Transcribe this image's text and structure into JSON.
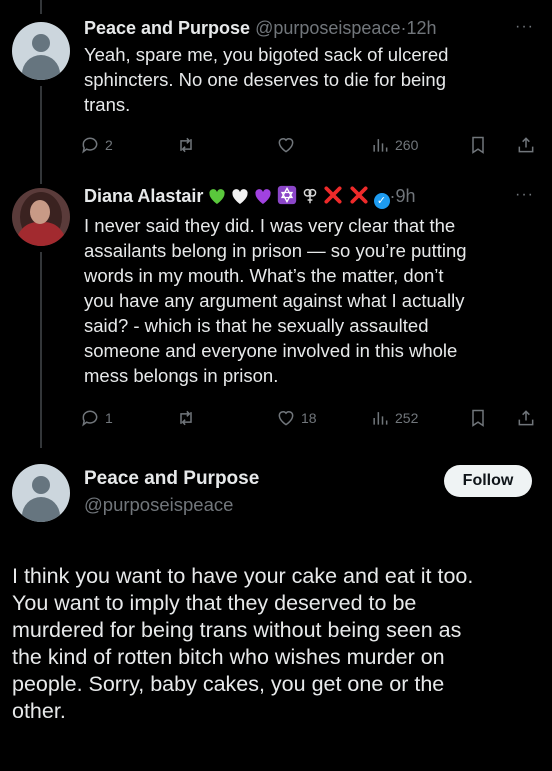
{
  "tweets": [
    {
      "name": "Peace and Purpose",
      "handle": "@purposeispeace",
      "separator": "·",
      "time": "12h",
      "text": "Yeah, spare me, you bigoted sack of ulcered\nsphincters. No one deserves to die for being\ntrans.",
      "replies": "2",
      "retweets": "",
      "likes": "",
      "views": "260"
    },
    {
      "name": "Diana Alastair",
      "name_emojis": [
        "green-heart",
        "white-heart",
        "purple-heart",
        "star-of-david",
        "gender-symbol",
        "red-x",
        "red-x"
      ],
      "separator": "·",
      "time": "9h",
      "text": "I never said they did. I was very clear that the\nassailants belong in prison — so you’re putting\nwords in my mouth. What’s the matter, don’t\nyou have any argument against what I actually\nsaid? - which is that he sexually assaulted\nsomeone and everyone involved in this whole\nmess belongs in prison.",
      "replies": "1",
      "retweets": "",
      "likes": "18",
      "views": "252"
    }
  ],
  "main_tweet": {
    "name": "Peace and Purpose",
    "handle": "@purposeispeace",
    "follow_label": "Follow",
    "text": "I think you want to have your cake and eat it too.\nYou want to imply that they deserved to be\nmurdered for being trans without being seen as\nthe  kind of rotten bitch who wishes murder on\npeople. Sorry, baby cakes, you get one or the\nother."
  },
  "more_label": "···",
  "colors": {
    "background": "#000000",
    "text": "#e7e9ea",
    "secondary": "#71767b",
    "verified": "#1d9bf0"
  }
}
